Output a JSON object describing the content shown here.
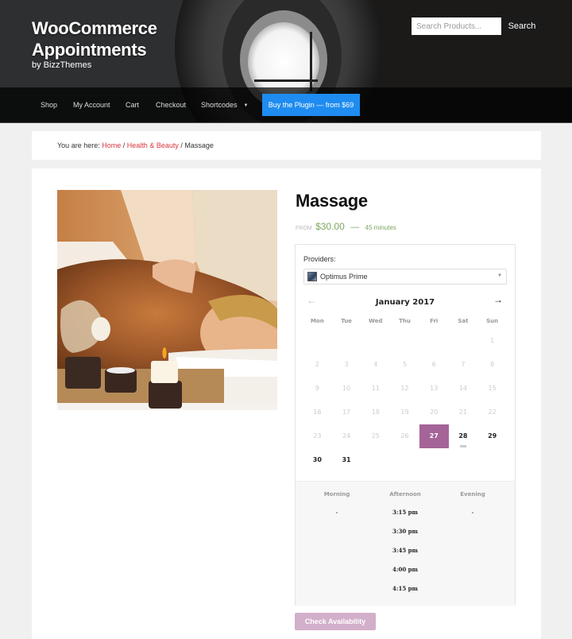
{
  "header": {
    "site_title": "WooCommerce Appointments",
    "site_subtitle": "by BizzThemes",
    "search": {
      "placeholder": "Search Products...",
      "value": "",
      "button_label": "Search"
    },
    "nav": [
      {
        "label": "Shop"
      },
      {
        "label": "My Account"
      },
      {
        "label": "Cart"
      },
      {
        "label": "Checkout"
      },
      {
        "label": "Shortcodes",
        "has_dropdown": true,
        "caret": "▼"
      }
    ],
    "cta_label": "Buy the Plugin — from $69",
    "cta_color": "#1e8cf0"
  },
  "breadcrumb": {
    "prefix": "You are here:",
    "items": [
      {
        "label": "Home",
        "link": true
      },
      {
        "label": "Health & Beauty",
        "link": true
      },
      {
        "label": "Massage",
        "link": false
      }
    ],
    "separator": "/"
  },
  "product": {
    "image_alt": "Woman receiving back massage with candles",
    "title": "Massage",
    "price_prefix": "FROM",
    "price": "$30.00",
    "dash": "—",
    "duration": "45 minutes"
  },
  "booking": {
    "providers_label": "Providers:",
    "provider_selected": "Optimus Prime",
    "select_caret": "▼",
    "calendar": {
      "prev_icon": "←",
      "next_icon": "→",
      "month_label": "January 2017",
      "weekdays": [
        "Mon",
        "Tue",
        "Wed",
        "Thu",
        "Fri",
        "Sat",
        "Sun"
      ],
      "weeks": [
        [
          null,
          null,
          null,
          null,
          null,
          null,
          1
        ],
        [
          2,
          3,
          4,
          5,
          6,
          7,
          8
        ],
        [
          9,
          10,
          11,
          12,
          13,
          14,
          15
        ],
        [
          16,
          17,
          18,
          19,
          20,
          21,
          22
        ],
        [
          23,
          24,
          25,
          26,
          27,
          28,
          29
        ],
        [
          30,
          31,
          null,
          null,
          null,
          null,
          null
        ]
      ],
      "selected_day": 27,
      "today": 28,
      "available_days": [
        27,
        28,
        29,
        30,
        31
      ],
      "selected_color": "#a46497"
    },
    "slots": {
      "columns": [
        {
          "label": "Morning",
          "times": [
            "-"
          ]
        },
        {
          "label": "Afternoon",
          "times": [
            "3:15 pm",
            "3:30 pm",
            "3:45 pm",
            "4:00 pm",
            "4:15 pm"
          ]
        },
        {
          "label": "Evening",
          "times": [
            "-"
          ]
        }
      ]
    },
    "check_button_label": "Check Availability",
    "check_button_color": "#d2afca"
  }
}
